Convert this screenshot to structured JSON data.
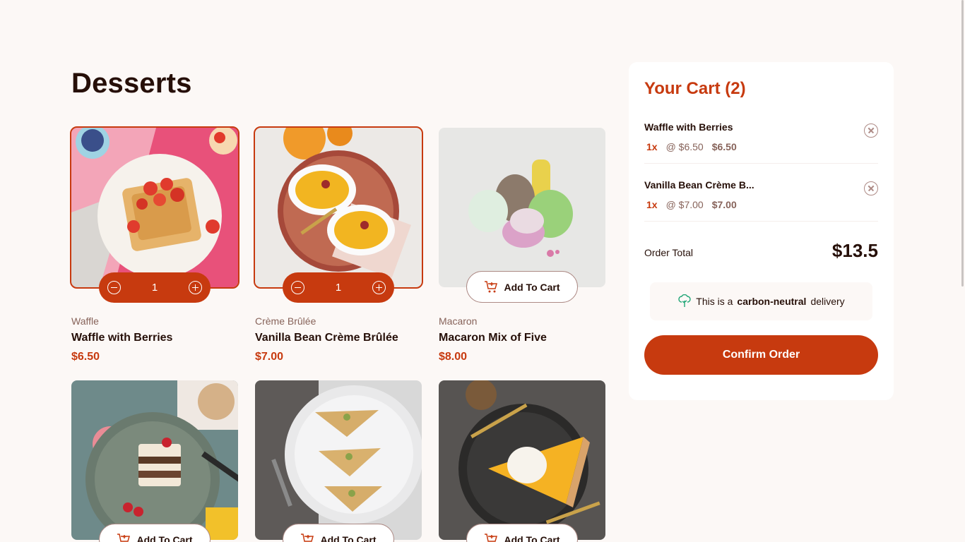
{
  "page": {
    "title": "Desserts"
  },
  "colors": {
    "accent": "#c73a0f",
    "text": "#260f08",
    "muted": "#87635a",
    "background": "#fcf8f6"
  },
  "products": [
    {
      "category": "Waffle",
      "name": "Waffle with Berries",
      "price": "$6.50",
      "in_cart": true,
      "quantity": "1"
    },
    {
      "category": "Crème Brûlée",
      "name": "Vanilla Bean Crème Brûlée",
      "price": "$7.00",
      "in_cart": true,
      "quantity": "1"
    },
    {
      "category": "Macaron",
      "name": "Macaron Mix of Five",
      "price": "$8.00",
      "in_cart": false
    },
    {
      "category": "",
      "name": "",
      "price": "",
      "in_cart": false
    },
    {
      "category": "",
      "name": "",
      "price": "",
      "in_cart": false
    },
    {
      "category": "",
      "name": "",
      "price": "",
      "in_cart": false
    }
  ],
  "add_to_cart_label": "Add To Cart",
  "cart": {
    "title": "Your Cart (2)",
    "items": [
      {
        "name": "Waffle with Berries",
        "qty": "1x",
        "unit": "@ $6.50",
        "total": "$6.50"
      },
      {
        "name": "Vanilla Bean Crème B...",
        "qty": "1x",
        "unit": "@ $7.00",
        "total": "$7.00"
      }
    ],
    "order_total_label": "Order Total",
    "order_total_value": "$13.5",
    "carbon_prefix": "This is a",
    "carbon_bold": "carbon-neutral",
    "carbon_suffix": "delivery",
    "confirm_label": "Confirm Order"
  },
  "icons": {
    "cart": "cart-add-icon",
    "remove": "remove-item-icon",
    "carbon": "tree-icon",
    "decrement": "minus-icon",
    "increment": "plus-icon"
  }
}
